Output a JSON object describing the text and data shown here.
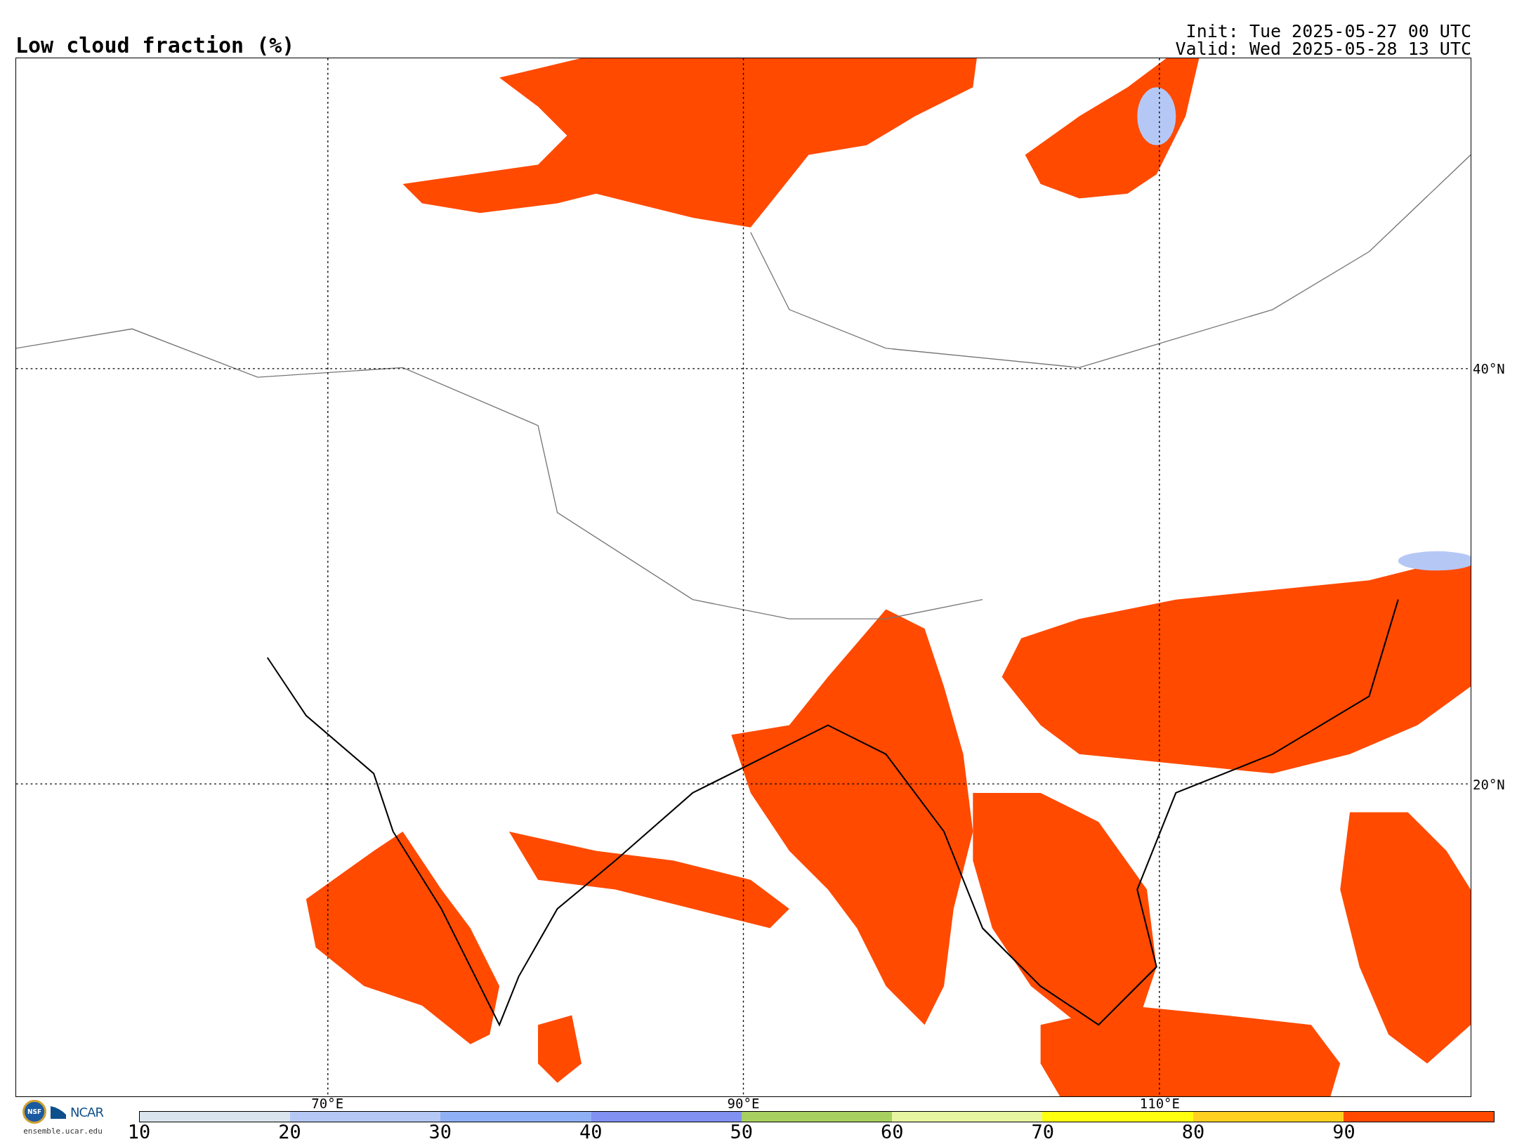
{
  "title": "Low cloud fraction (%)",
  "init": "Init: Tue 2025-05-27 00 UTC",
  "valid": "Valid: Wed 2025-05-28 13 UTC",
  "map": {
    "lat_labels": [
      "40°N",
      "20°N"
    ],
    "lon_labels": [
      "70°E",
      "90°E",
      "110°E"
    ]
  },
  "colorbar": {
    "bins": [
      {
        "color": "#d9e4ee"
      },
      {
        "color": "#b5c8f5"
      },
      {
        "color": "#90b0f5"
      },
      {
        "color": "#8191f2"
      },
      {
        "color": "#a8d060"
      },
      {
        "color": "#e8f5a0"
      },
      {
        "color": "#ffff10"
      },
      {
        "color": "#ffd020"
      },
      {
        "color": "#ff4a00"
      }
    ],
    "ticks": [
      "10",
      "20",
      "30",
      "40",
      "50",
      "60",
      "70",
      "80",
      "90"
    ]
  },
  "logo": {
    "seal": "NSF",
    "name": "NCAR",
    "site": "ensemble.ucar.edu"
  }
}
